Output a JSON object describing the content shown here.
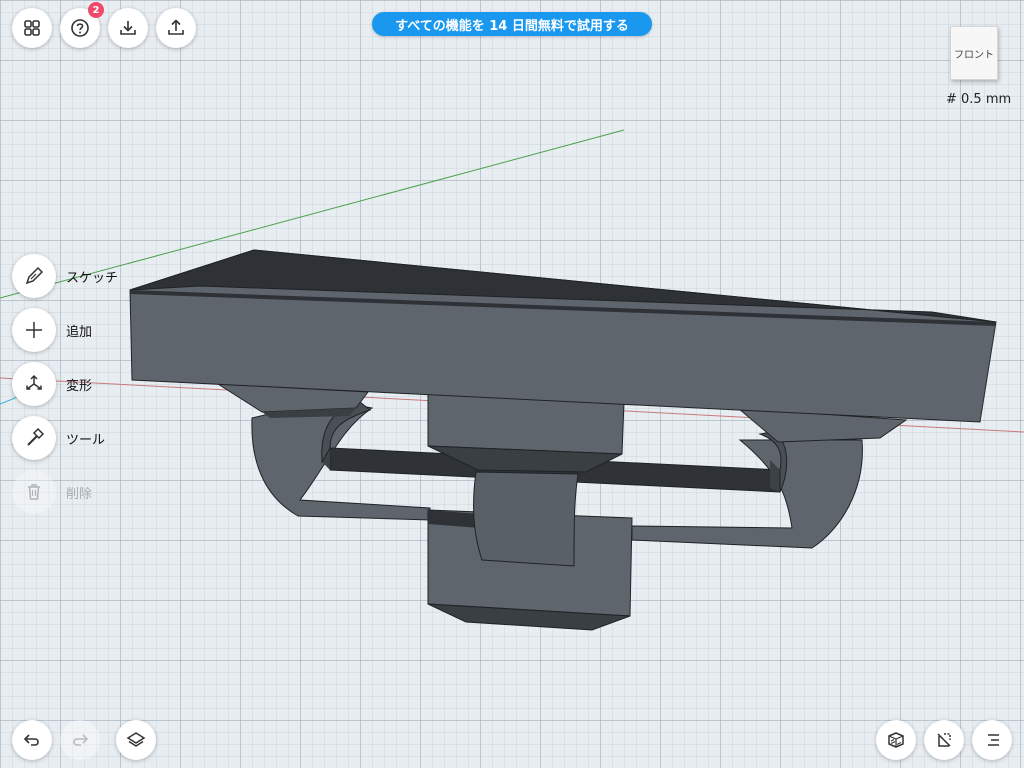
{
  "toolbar": {
    "help_badge": "2"
  },
  "banner": {
    "trial_text": "すべての機能を 14 日間無料で試用する"
  },
  "view": {
    "cube_face": "フロント",
    "grid_size": "# 0.5 mm"
  },
  "tools": {
    "sketch": "スケッチ",
    "add": "追加",
    "transform": "変形",
    "tools": "ツール",
    "delete": "削除"
  },
  "colors": {
    "accent": "#1a98f0",
    "badge": "#ef4a6b",
    "model_top": "#2e3236",
    "model_front": "#5f656c",
    "axis_x": "#c87a7a",
    "axis_y": "#4aa04a",
    "axis_z": "#3ab0d8"
  },
  "icons": {
    "grid_menu": "grid-icon",
    "help": "question-icon",
    "import": "download-icon",
    "export": "share-icon",
    "undo": "undo-icon",
    "redo": "redo-icon",
    "layers": "layers-icon",
    "display_mode": "display-mode-icon",
    "visibility": "visibility-icon",
    "outline": "outline-icon"
  }
}
